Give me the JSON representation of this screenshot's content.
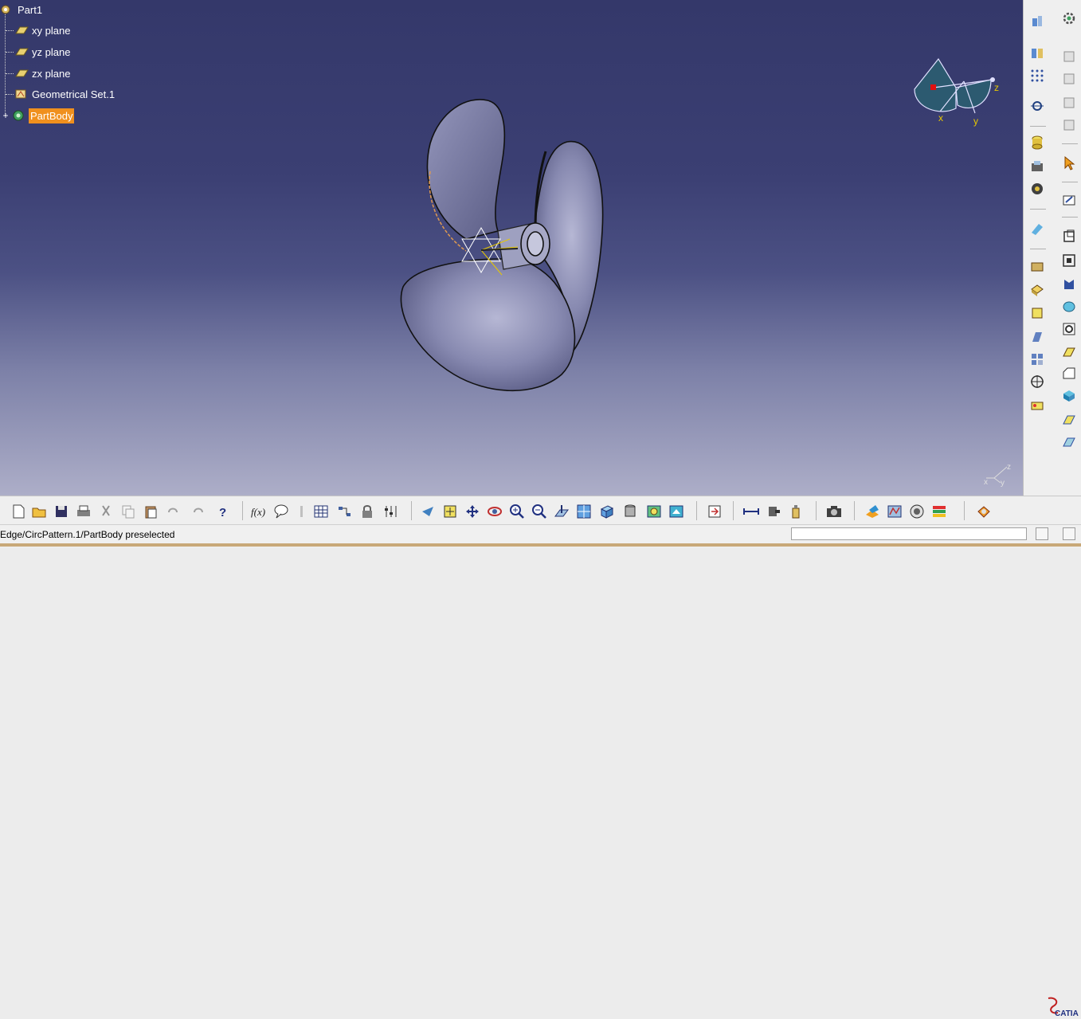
{
  "tree": {
    "root": "Part1",
    "items": [
      {
        "label": "xy plane",
        "icon": "plane-icon"
      },
      {
        "label": "yz plane",
        "icon": "plane-icon"
      },
      {
        "label": "zx plane",
        "icon": "plane-icon"
      },
      {
        "label": "Geometrical Set.1",
        "icon": "geometrical-set-icon"
      },
      {
        "label": "PartBody",
        "icon": "gear-body-icon",
        "selected": true
      }
    ]
  },
  "compass": {
    "x": "x",
    "y": "y",
    "z": "z"
  },
  "axis_triad": {
    "x": "x",
    "y": "y",
    "z": "z"
  },
  "status": {
    "text": "Edge/CircPattern.1/PartBody preselected",
    "command_placeholder": ""
  },
  "logo": {
    "brand": "CATIA"
  },
  "colors": {
    "selection": "#f0901e",
    "viewport_top": "#34386a",
    "part": "#6a6c94"
  }
}
